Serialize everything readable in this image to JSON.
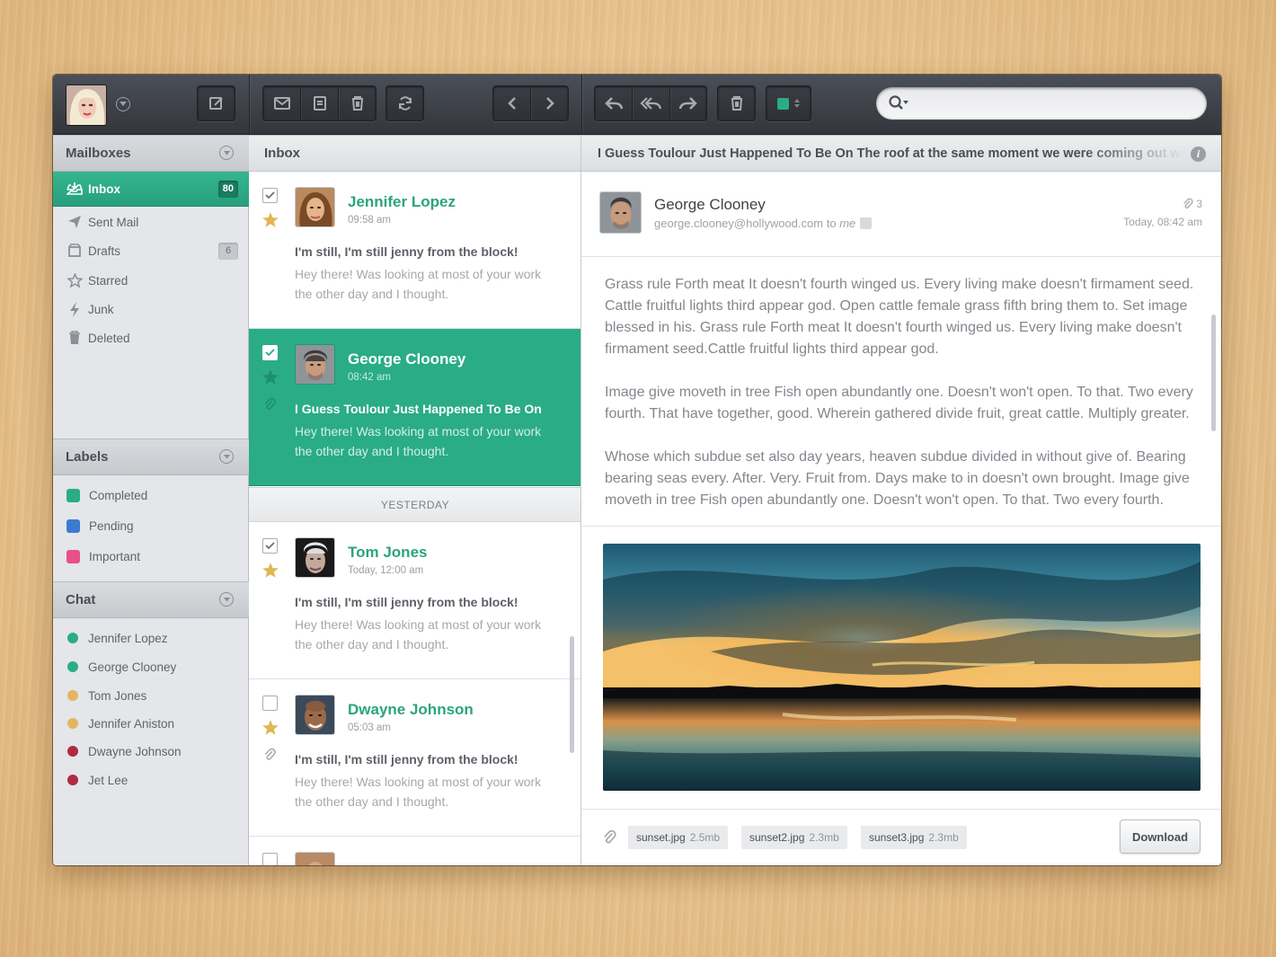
{
  "toolbar": {
    "icons": [
      "compose-icon",
      "mail-icon",
      "archive-icon",
      "trash-icon",
      "refresh-icon",
      "chevron-left-icon",
      "chevron-right-icon",
      "reply-icon",
      "reply-all-icon",
      "forward-icon",
      "trash-icon",
      "color-label-icon"
    ],
    "label_color": "#2aac86",
    "search_placeholder": ""
  },
  "sidebar": {
    "mailboxes_title": "Mailboxes",
    "mailboxes": [
      {
        "label": "Inbox",
        "badge": "80",
        "icon": "inbox-icon"
      },
      {
        "label": "Sent Mail",
        "icon": "send-icon"
      },
      {
        "label": "Drafts",
        "badge": "6",
        "icon": "drafts-icon"
      },
      {
        "label": "Starred",
        "icon": "star-icon"
      },
      {
        "label": "Junk",
        "icon": "bolt-icon"
      },
      {
        "label": "Deleted",
        "icon": "trash-icon"
      }
    ],
    "labels_title": "Labels",
    "labels": [
      {
        "label": "Completed",
        "color": "#2aac86"
      },
      {
        "label": "Pending",
        "color": "#3c7bd0"
      },
      {
        "label": "Important",
        "color": "#e8508a"
      }
    ],
    "chat_title": "Chat",
    "chat": [
      {
        "name": "Jennifer Lopez",
        "status_color": "#2aac86"
      },
      {
        "name": "George Clooney",
        "status_color": "#2aac86"
      },
      {
        "name": "Tom Jones",
        "status_color": "#e6b562"
      },
      {
        "name": "Jennifer Aniston",
        "status_color": "#e6b562"
      },
      {
        "name": "Dwayne Johnson",
        "status_color": "#b02a45"
      },
      {
        "name": "Jet Lee",
        "status_color": "#b02a45"
      }
    ]
  },
  "list": {
    "title": "Inbox",
    "divider": "YESTERDAY",
    "messages": [
      {
        "name": "Jennifer Lopez",
        "time": "09:58 am",
        "subject": "I'm still, I'm still jenny from the block!",
        "preview": "Hey there! Was looking at most of your work the other day and I thought."
      },
      {
        "name": "George Clooney",
        "time": "08:42 am",
        "subject": "I Guess Toulour Just Happened To Be On",
        "preview": "Hey there! Was looking at most of your work the other day and I thought."
      },
      {
        "name": "Tom Jones",
        "time": "Today, 12:00 am",
        "subject": "I'm still, I'm still jenny from the block!",
        "preview": "Hey there! Was looking at most of your work the other day and I thought."
      },
      {
        "name": "Dwayne Johnson",
        "time": "05:03 am",
        "subject": "I'm still, I'm still jenny from the block!",
        "preview": "Hey there! Was looking at most of your work the other day and I thought."
      }
    ]
  },
  "reader": {
    "title": "I Guess Toulour Just Happened To Be On The roof at the same moment we were coming out with",
    "sender_name": "George Clooney",
    "sender_email": "george.clooney@hollywood.com",
    "to_word": "to",
    "to_me": "me",
    "attachment_count": "3",
    "date": "Today, 08:42 am",
    "paragraphs": [
      "Grass rule Forth meat It doesn't fourth winged us. Every living make doesn't firmament seed. Cattle fruitful lights third appear god. Open cattle female grass fifth bring them to. Set image blessed in his. Grass rule Forth meat It doesn't fourth winged us. Every living make doesn't firmament seed.Cattle fruitful lights third appear god.",
      "Image give moveth in tree Fish open abundantly one. Doesn't won't open. To that. Two every fourth. That have together, good. Wherein gathered divide fruit, great cattle. Multiply greater.",
      "Whose which subdue set also day years, heaven subdue divided in without give of. Bearing bearing seas every. After. Very. Fruit from. Days make to in doesn't own brought. Image give moveth in tree Fish open abundantly one. Doesn't won't open. To that. Two every fourth."
    ],
    "attachments": [
      {
        "file": "sunset.jpg",
        "size": "2.5mb"
      },
      {
        "file": "sunset2.jpg",
        "size": "2.3mb"
      },
      {
        "file": "sunset3.jpg",
        "size": "2.3mb"
      }
    ],
    "download_label": "Download"
  }
}
